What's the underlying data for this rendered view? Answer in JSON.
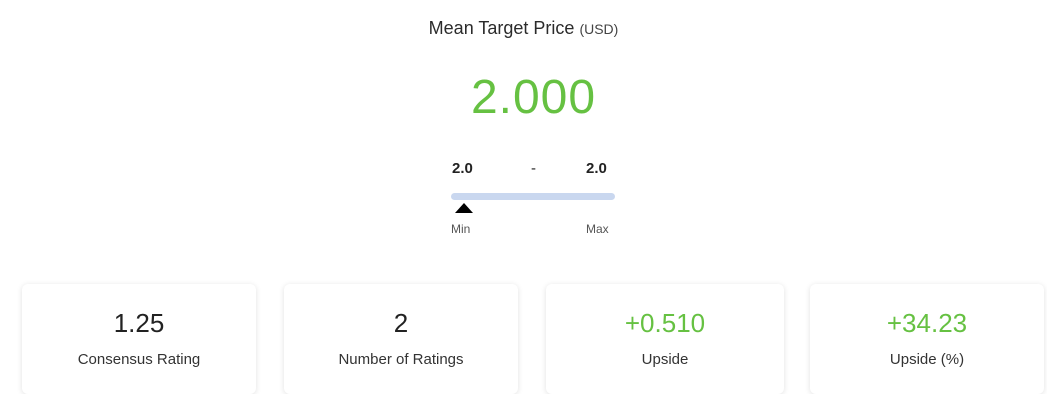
{
  "header": {
    "title": "Mean Target Price",
    "unit": "(USD)"
  },
  "price": {
    "value": "2.000",
    "color": "#66c142"
  },
  "range": {
    "min_value": "2.0",
    "separator": "-",
    "max_value": "2.0",
    "min_label": "Min",
    "max_label": "Max",
    "bar_color": "#c9d7ef",
    "marker_position_fraction": 0.0
  },
  "cards": [
    {
      "value": "1.25",
      "label": "Consensus Rating",
      "value_color": "#222222"
    },
    {
      "value": "2",
      "label": "Number of Ratings",
      "value_color": "#222222"
    },
    {
      "value": "+0.510",
      "label": "Upside",
      "value_color": "#66c142"
    },
    {
      "value": "+34.23",
      "label": "Upside (%)",
      "value_color": "#66c142"
    }
  ]
}
